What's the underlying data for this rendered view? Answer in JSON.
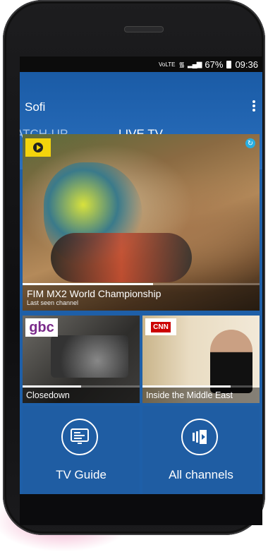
{
  "status_bar": {
    "network": "VoLTE",
    "battery": "67%",
    "time": "09:36"
  },
  "app": {
    "title": "Sofi"
  },
  "tabs": [
    {
      "label": "ATCH-UP",
      "selected": false
    },
    {
      "label": "LIVE TV",
      "selected": true
    }
  ],
  "featured": {
    "title": "FIM MX2 World Championship",
    "subtitle": "Last seen channel",
    "progress": 0.55
  },
  "channels": [
    {
      "logo": "gbc",
      "title": "Closedown",
      "progress": 0.5
    },
    {
      "logo": "CNN",
      "title": "Inside the Middle East",
      "progress": 0.75
    }
  ],
  "actions": [
    {
      "label": "TV Guide",
      "icon": "tv-guide-icon"
    },
    {
      "label": "All channels",
      "icon": "all-channels-icon"
    }
  ]
}
